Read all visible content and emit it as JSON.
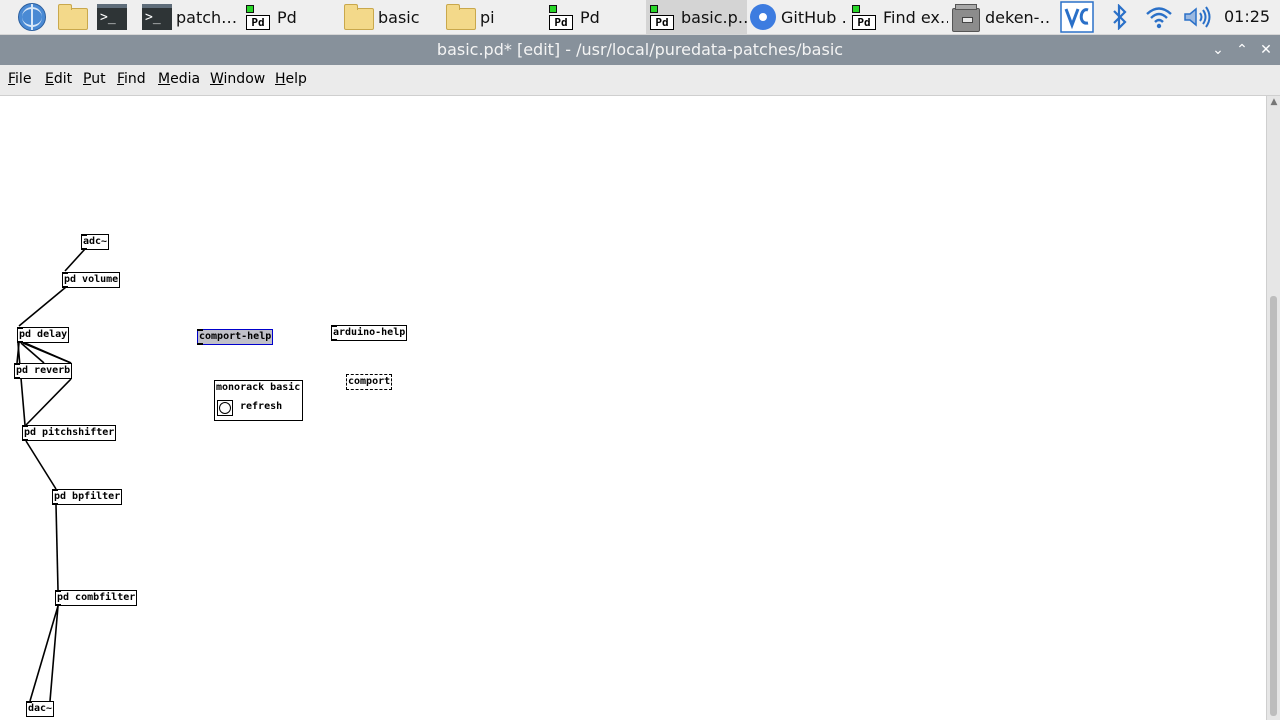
{
  "taskbar": {
    "items": [
      {
        "label": "",
        "icon": "globe-icon"
      },
      {
        "label": "",
        "icon": "folder-icon"
      },
      {
        "label": "",
        "icon": "terminal-icon"
      },
      {
        "label": "patch…",
        "icon": "terminal-icon"
      },
      {
        "label": "Pd",
        "icon": "puredata-icon"
      },
      {
        "label": "basic",
        "icon": "folder-icon"
      },
      {
        "label": "pi",
        "icon": "folder-icon"
      },
      {
        "label": "Pd",
        "icon": "puredata-icon"
      },
      {
        "label": "basic.p…",
        "icon": "puredata-icon",
        "active": true
      },
      {
        "label": "GitHub …",
        "icon": "chromium-icon"
      },
      {
        "label": "Find ex…",
        "icon": "puredata-icon"
      },
      {
        "label": "deken-…",
        "icon": "archive-icon"
      }
    ],
    "tray": {
      "vnc_icon": "vnc-icon",
      "bluetooth_icon": "bluetooth-icon",
      "wifi_icon": "wifi-icon",
      "volume_icon": "volume-icon",
      "clock": "01:25"
    }
  },
  "window": {
    "title": "basic.pd* [edit] - /usr/local/puredata-patches/basic",
    "controls": {
      "minimize": "⌄",
      "maximize": "⌃",
      "close": "✕"
    }
  },
  "menubar": {
    "items": [
      {
        "label": "File",
        "accel": "F",
        "rest": "ile"
      },
      {
        "label": "Edit",
        "accel": "E",
        "rest": "dit"
      },
      {
        "label": "Put",
        "accel": "P",
        "rest": "ut"
      },
      {
        "label": "Find",
        "accel": "F",
        "rest": "ind"
      },
      {
        "label": "Media",
        "accel": "M",
        "rest": "edia"
      },
      {
        "label": "Window",
        "accel": "W",
        "rest": "indow"
      },
      {
        "label": "Help",
        "accel": "H",
        "rest": "elp"
      }
    ]
  },
  "patch": {
    "objects": {
      "adc": "adc~",
      "volume": "pd volume",
      "delay": "pd delay",
      "reverb": "pd reverb",
      "pitchshifter": "pd pitchshifter",
      "bpfilter": "pd bpfilter",
      "combfilter": "pd combfilter",
      "dac": "dac~",
      "comport_help": "comport-help",
      "arduino_help": "arduino-help",
      "comport": "comport"
    },
    "subpatch": {
      "label": "monorack basic",
      "refresh": "refresh"
    }
  },
  "colors": {
    "titlebar": "#87919b",
    "selection": "#0000cc",
    "taskbar": "#efefef"
  }
}
